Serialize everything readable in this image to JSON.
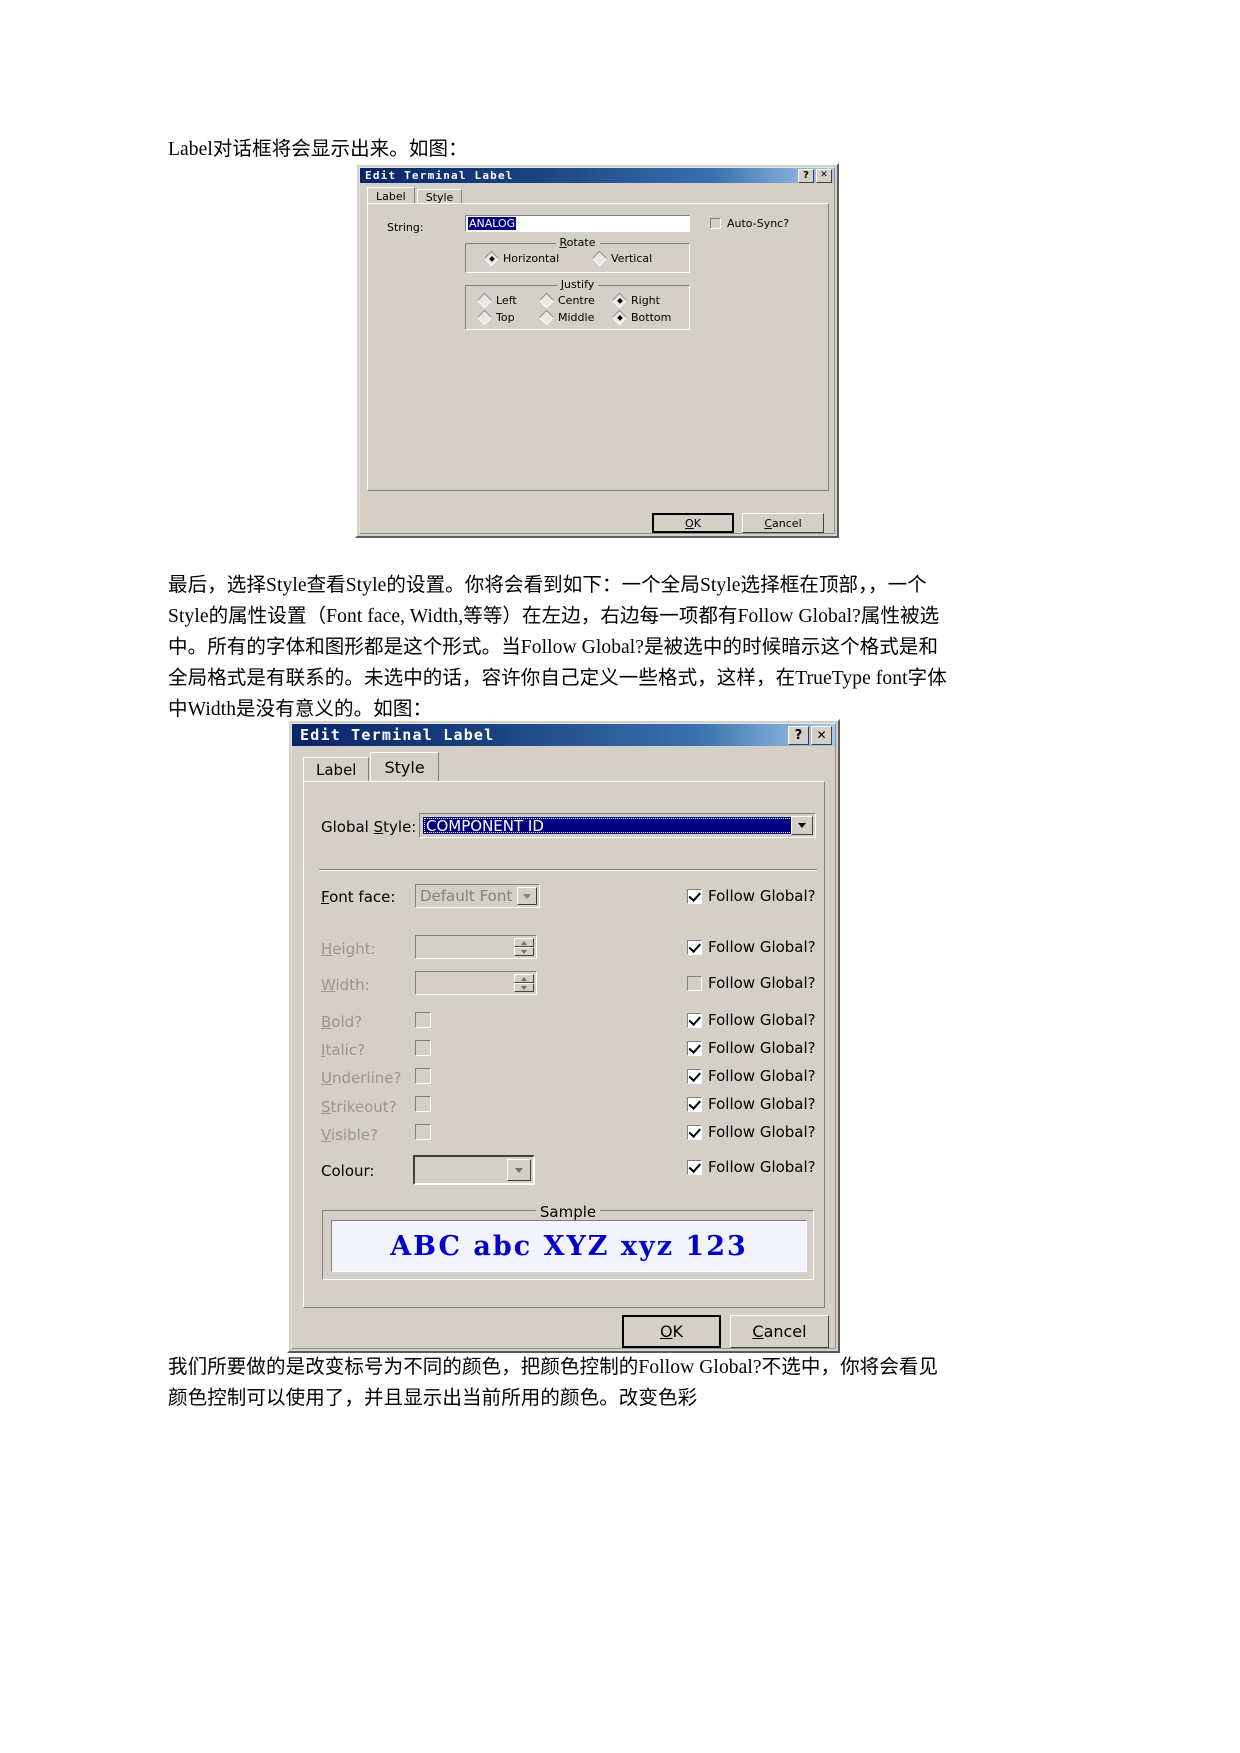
{
  "document": {
    "paragraph_1": "Label对话框将会显示出来。如图：",
    "paragraph_2": "最后，选择Style查看Style的设置。你将会看到如下：一个全局Style选择框在顶部，，一个Style的属性设置（Font face, Width,等等）在左边，右边每一项都有Follow Global?属性被选中。所有的字体和图形都是这个形式。当Follow Global?是被选中的时候暗示这个格式是和全局格式是有联系的。未选中的话，容许你自己定义一些格式，这样，在TrueType font字体中Width是没有意义的。如图：",
    "paragraph_3": "我们所要做的是改变标号为不同的颜色，把颜色控制的Follow Global?不选中，你将会看见颜色控制可以使用了，并且显示出当前所用的颜色。改变色彩"
  },
  "dialog_label": {
    "title": "Edit Terminal Label",
    "titlebar_buttons": [
      {
        "name": "help-button",
        "glyph": "?"
      },
      {
        "name": "close-button",
        "glyph": "✕"
      }
    ],
    "tabs": [
      {
        "label": "Label",
        "selected": true
      },
      {
        "label": "Style",
        "selected": false
      }
    ],
    "string_label": "String:",
    "string_value": "ANALOG",
    "autosync_label": "Auto-Sync?",
    "autosync_checked": false,
    "autosync_disabled": true,
    "rotate": {
      "legend": "Rotate",
      "legend_accel": "R",
      "options": [
        {
          "label": "Horizontal",
          "selected": true
        },
        {
          "label": "Vertical",
          "selected": false
        }
      ]
    },
    "justify": {
      "legend": "Justify",
      "legend_accel": "J",
      "row1": [
        {
          "label": "Left",
          "selected": false
        },
        {
          "label": "Centre",
          "selected": false
        },
        {
          "label": "Right",
          "selected": true
        }
      ],
      "row2": [
        {
          "label": "Top",
          "selected": false
        },
        {
          "label": "Middle",
          "selected": false
        },
        {
          "label": "Bottom",
          "selected": true
        }
      ]
    },
    "buttons": {
      "ok": "OK",
      "ok_accel": "O",
      "cancel": "Cancel",
      "cancel_accel": "C"
    }
  },
  "dialog_style": {
    "title": "Edit Terminal Label",
    "titlebar_buttons": [
      {
        "name": "help-button",
        "glyph": "?"
      },
      {
        "name": "close-button",
        "glyph": "✕"
      }
    ],
    "tabs": [
      {
        "label": "Label",
        "selected": false
      },
      {
        "label": "Style",
        "selected": true
      }
    ],
    "global_style": {
      "label": "Global Style:",
      "value": "COMPONENT ID"
    },
    "rows": [
      {
        "label": "Font face:",
        "control": "combo",
        "value": "Default Font",
        "disabled_label": false,
        "follow_label": "Follow Global?",
        "follow_checked": true,
        "follow_disabled": false
      },
      {
        "label": "Height:",
        "control": "spinner",
        "value": "",
        "disabled_label": true,
        "follow_label": "Follow Global?",
        "follow_checked": true,
        "follow_disabled": false
      },
      {
        "label": "Width:",
        "control": "spinner",
        "value": "",
        "disabled_label": true,
        "follow_label": "Follow Global?",
        "follow_checked": false,
        "follow_disabled": true
      },
      {
        "label": "Bold?",
        "control": "checkbox",
        "value": "",
        "disabled_label": true,
        "follow_label": "Follow Global?",
        "follow_checked": true,
        "follow_disabled": false
      },
      {
        "label": "Italic?",
        "control": "checkbox",
        "value": "",
        "disabled_label": true,
        "follow_label": "Follow Global?",
        "follow_checked": true,
        "follow_disabled": false
      },
      {
        "label": "Underline?",
        "control": "checkbox",
        "value": "",
        "disabled_label": true,
        "follow_label": "Follow Global?",
        "follow_checked": true,
        "follow_disabled": false
      },
      {
        "label": "Strikeout?",
        "control": "checkbox",
        "value": "",
        "disabled_label": true,
        "follow_label": "Follow Global?",
        "follow_checked": true,
        "follow_disabled": false
      },
      {
        "label": "Visible?",
        "control": "checkbox",
        "value": "",
        "disabled_label": true,
        "follow_label": "Follow Global?",
        "follow_checked": true,
        "follow_disabled": false
      },
      {
        "label": "Colour:",
        "control": "colour",
        "value": "",
        "disabled_label": false,
        "follow_label": "Follow Global?",
        "follow_checked": true,
        "follow_disabled": false
      }
    ],
    "sample": {
      "legend": "Sample",
      "text": "ABC abc XYZ xyz 123",
      "colour": "#0000cc"
    },
    "buttons": {
      "ok": "OK",
      "ok_accel": "O",
      "cancel": "Cancel",
      "cancel_accel": "C"
    }
  }
}
